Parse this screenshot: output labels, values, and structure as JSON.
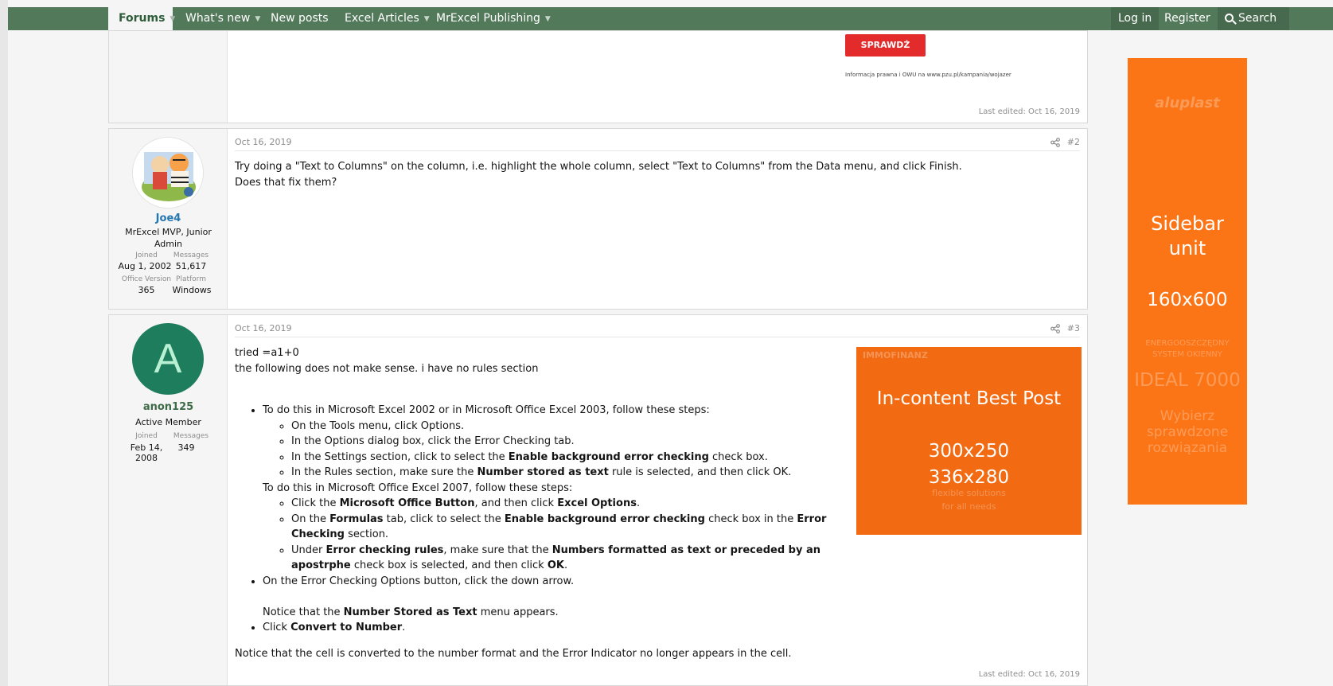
{
  "nav": {
    "forums": "Forums",
    "whats_new": "What's new",
    "new_posts": "New posts",
    "excel_articles": "Excel Articles",
    "publishing": "MrExcel Publishing",
    "login": "Log in",
    "register": "Register",
    "search": "Search"
  },
  "top_ad": {
    "button": "SPRAWDŹ",
    "small_text": "Informacja prawna i OWU na www.pzu.pl/kampania/wojazer"
  },
  "post1": {
    "last_edited": "Last edited: Oct 16, 2019"
  },
  "post2": {
    "date": "Oct 16, 2019",
    "number": "#2",
    "username": "Joe4",
    "user_title": "MrExcel MVP, Junior Admin",
    "joined_label": "Joined",
    "joined": "Aug 1, 2002",
    "messages_label": "Messages",
    "messages": "51,617",
    "office_label": "Office Version",
    "office": "365",
    "platform_label": "Platform",
    "platform": "Windows",
    "line1": "Try doing a \"Text to Columns\" on the column, i.e. highlight the whole column, select \"Text to Columns\" from the Data menu, and click Finish.",
    "line2": "Does that fix them?"
  },
  "post3": {
    "date": "Oct 16, 2019",
    "number": "#3",
    "avatar_letter": "A",
    "username": "anon125",
    "user_title": "Active Member",
    "joined_label": "Joined",
    "joined": "Feb 14, 2008",
    "messages_label": "Messages",
    "messages": "349",
    "intro1": "tried =a1+0",
    "intro2": "the following does not make sense. i have no rules section",
    "b1": "To do this in Microsoft Excel 2002 or in Microsoft Office Excel 2003, follow these steps:",
    "b1a": "On the Tools menu, click Options.",
    "b1b": "In the Options dialog box, click the Error Checking tab.",
    "b1c_pre": "In the Settings section, click to select the ",
    "b1c_bold": "Enable background error checking",
    "b1c_post": " check box.",
    "b1d_pre": "In the Rules section, make sure the ",
    "b1d_bold": "Number stored as text",
    "b1d_post": " rule is selected, and then click OK.",
    "b2": "To do this in Microsoft Office Excel 2007, follow these steps:",
    "b2a_pre": "Click the ",
    "b2a_bold1": "Microsoft Office Button",
    "b2a_mid": ", and then click ",
    "b2a_bold2": "Excel Options",
    "b2a_post": ".",
    "b2b_pre": "On the ",
    "b2b_bold1": "Formulas",
    "b2b_mid1": " tab, click to select the ",
    "b2b_bold2": "Enable background error checking",
    "b2b_mid2": " check box in the ",
    "b2b_bold3": "Error Checking",
    "b2b_post": " section.",
    "b2c_pre": "Under ",
    "b2c_bold1": "Error checking rules",
    "b2c_mid": ", make sure that the ",
    "b2c_bold2": "Numbers formatted as text or preceded by an apostrphe",
    "b2c_mid2": " check box is selected, and then click ",
    "b2c_bold3": "OK",
    "b2c_post": ".",
    "b3": "On the Error Checking Options button, click the down arrow.",
    "notice1_pre": "Notice that the ",
    "notice1_bold": "Number Stored as Text",
    "notice1_post": " menu appears.",
    "b4_pre": "Click ",
    "b4_bold": "Convert to Number",
    "b4_post": ".",
    "outro": "Notice that the cell is converted to the number format and the Error Indicator no longer appears in the cell.",
    "last_edited": "Last edited: Oct 16, 2019"
  },
  "ad_incontent": {
    "title": "In-content Best Post",
    "size1": "300x250",
    "size2": "336x280",
    "faint_top": "IMMOFINANZ",
    "faint_sub1": "flexible solutions",
    "faint_sub2": "for all needs"
  },
  "ad_sidebar": {
    "title1": "Sidebar",
    "title2": "unit",
    "size": "160x600",
    "faint_brand": "aluplast",
    "faint_line1": "ENERGOOSZCZĘDNY",
    "faint_line2": "SYSTEM OKIENNY",
    "faint_model": "IDEAL 7000",
    "faint_cta1": "Wybierz",
    "faint_cta2": "sprawdzone",
    "faint_cta3": "rozwiązania"
  }
}
